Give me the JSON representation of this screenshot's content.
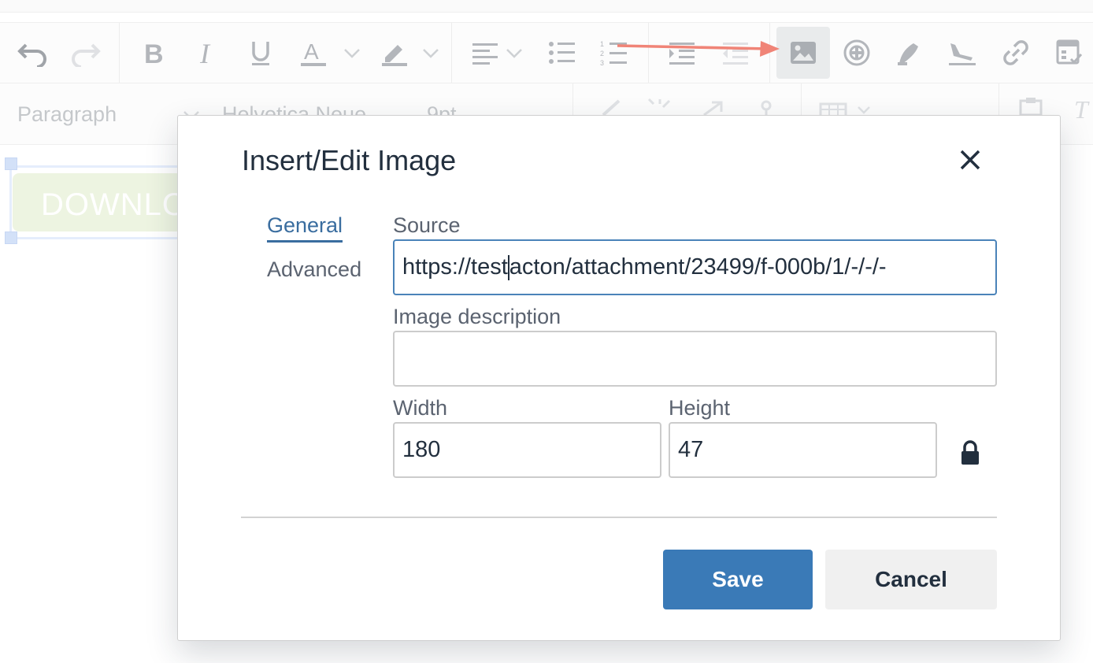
{
  "toolbar": {
    "paragraph_label": "Paragraph",
    "font_label": "Helvetica Neue",
    "size_label": "9pt"
  },
  "content": {
    "button_text": "DOWNLOAD"
  },
  "dialog": {
    "title": "Insert/Edit Image",
    "tabs": {
      "general": "General",
      "advanced": "Advanced"
    },
    "source": {
      "label": "Source",
      "value_before_caret": "https://test",
      "value_after_caret": "acton/attachment/23499/f-000b/1/-/-/-"
    },
    "description": {
      "label": "Image description",
      "value": ""
    },
    "width": {
      "label": "Width",
      "value": "180"
    },
    "height": {
      "label": "Height",
      "value": "47"
    },
    "buttons": {
      "save": "Save",
      "cancel": "Cancel"
    }
  },
  "colors": {
    "accent": "#3a7ab7",
    "arrow": "#e8432e"
  }
}
